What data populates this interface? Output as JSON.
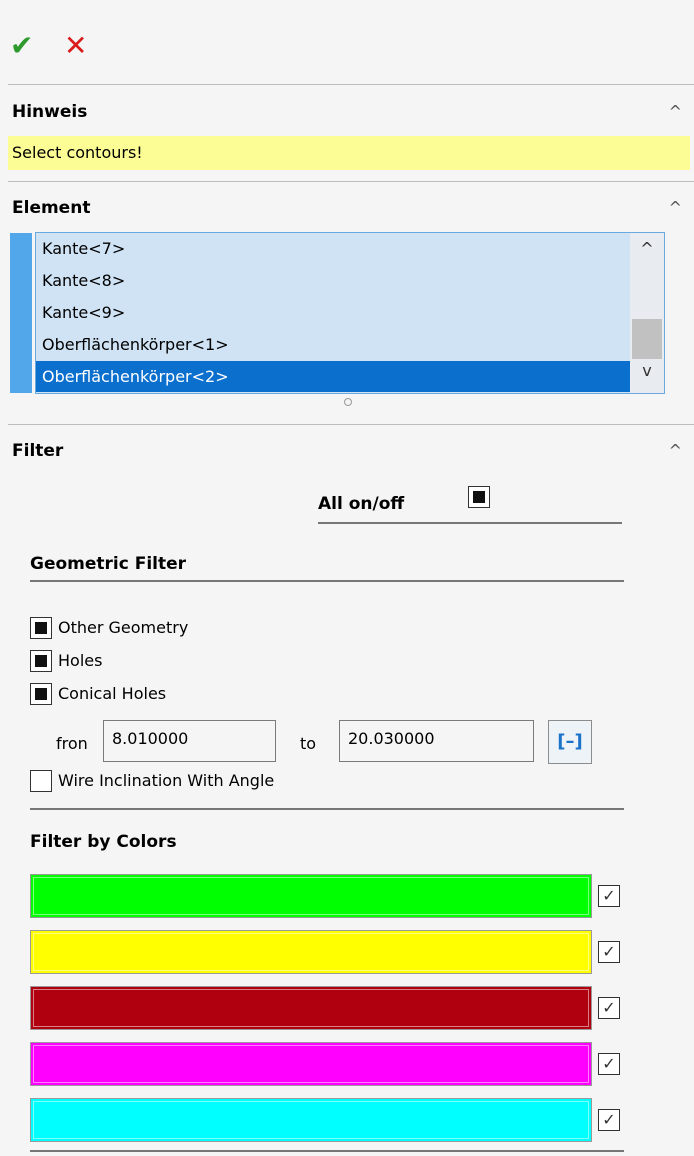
{
  "toolbar": {
    "ok_icon": "✔",
    "cancel_icon": "✕"
  },
  "hint_section": {
    "title": "Hinweis",
    "message": "Select contours!"
  },
  "element_section": {
    "title": "Element",
    "items": [
      {
        "label": "Kante<7>",
        "selected": false
      },
      {
        "label": "Kante<8>",
        "selected": false
      },
      {
        "label": "Kante<9>",
        "selected": false
      },
      {
        "label": "Oberflächenkörper<1>",
        "selected": false
      },
      {
        "label": "Oberflächenkörper<2>",
        "selected": true
      }
    ]
  },
  "filter_section": {
    "title": "Filter",
    "all_toggle_label": "All on/off",
    "all_toggle_checked": true,
    "geometric": {
      "title": "Geometric Filter",
      "options": [
        {
          "label": "Other Geometry",
          "checked": true
        },
        {
          "label": "Holes",
          "checked": true
        },
        {
          "label": "Conical Holes",
          "checked": true
        }
      ],
      "from_label": "fron",
      "from_value": "8.010000",
      "to_label": "to",
      "to_value": "20.030000",
      "range_button": "[–]",
      "wire_option": {
        "label": "Wire Inclination With Angle",
        "checked": false
      }
    },
    "colors": {
      "title": "Filter by Colors",
      "swatches": [
        {
          "color": "#00ff00",
          "checked": true
        },
        {
          "color": "#ffff00",
          "checked": true
        },
        {
          "color": "#b00010",
          "checked": true
        },
        {
          "color": "#ff00ff",
          "checked": true
        },
        {
          "color": "#00ffff",
          "checked": true
        }
      ]
    }
  },
  "icons": {
    "chevron": "^",
    "check": "✓",
    "scroll_up": "^",
    "scroll_down": "v"
  }
}
